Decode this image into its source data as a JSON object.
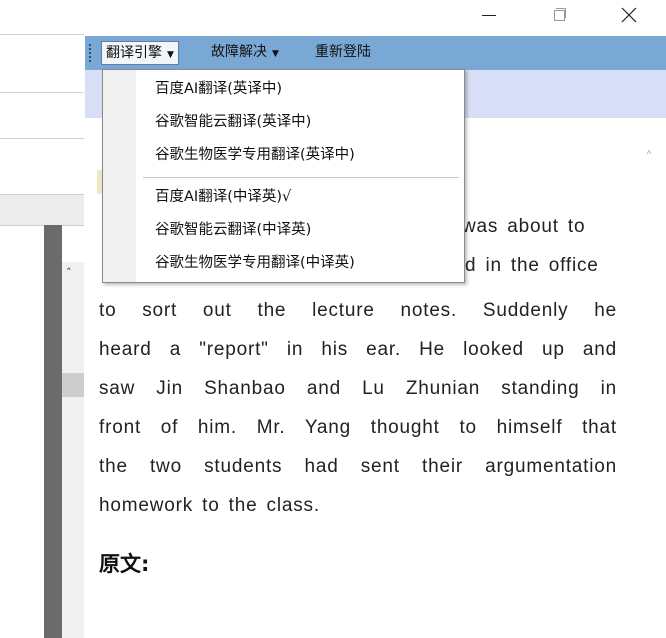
{
  "window": {
    "minimize_icon": "minimize-icon",
    "maximize_icon": "restore-icon",
    "close_icon": "close-icon"
  },
  "toolbar": {
    "engine_label": "翻译引擎",
    "troubleshoot_label": "故障解决",
    "relogin_label": "重新登陆"
  },
  "menu": {
    "items": [
      "百度AI翻译(英译中)",
      "谷歌智能云翻译(英译中)",
      "谷歌生物医学专用翻译(英译中)",
      "百度AI翻译(中译英)√",
      "谷歌智能云翻译(中译英)",
      "谷歌生物医学专用翻译(中译英)"
    ]
  },
  "content": {
    "line1_visible": "was about to",
    "line2_visible": "d in the office",
    "lines": [
      "to sort out the lecture notes. Suddenly he",
      "heard a \"report\" in his ear. He looked up and",
      "saw Jin Shanbao and Lu Zhunian standing in",
      "front of him. Mr. Yang thought to himself that",
      "the two students had sent their argumentation",
      "homework to the class."
    ],
    "heading": "原文:"
  },
  "colors": {
    "toolbar_bg": "#7aa8d4",
    "light_band": "#d7def5"
  }
}
